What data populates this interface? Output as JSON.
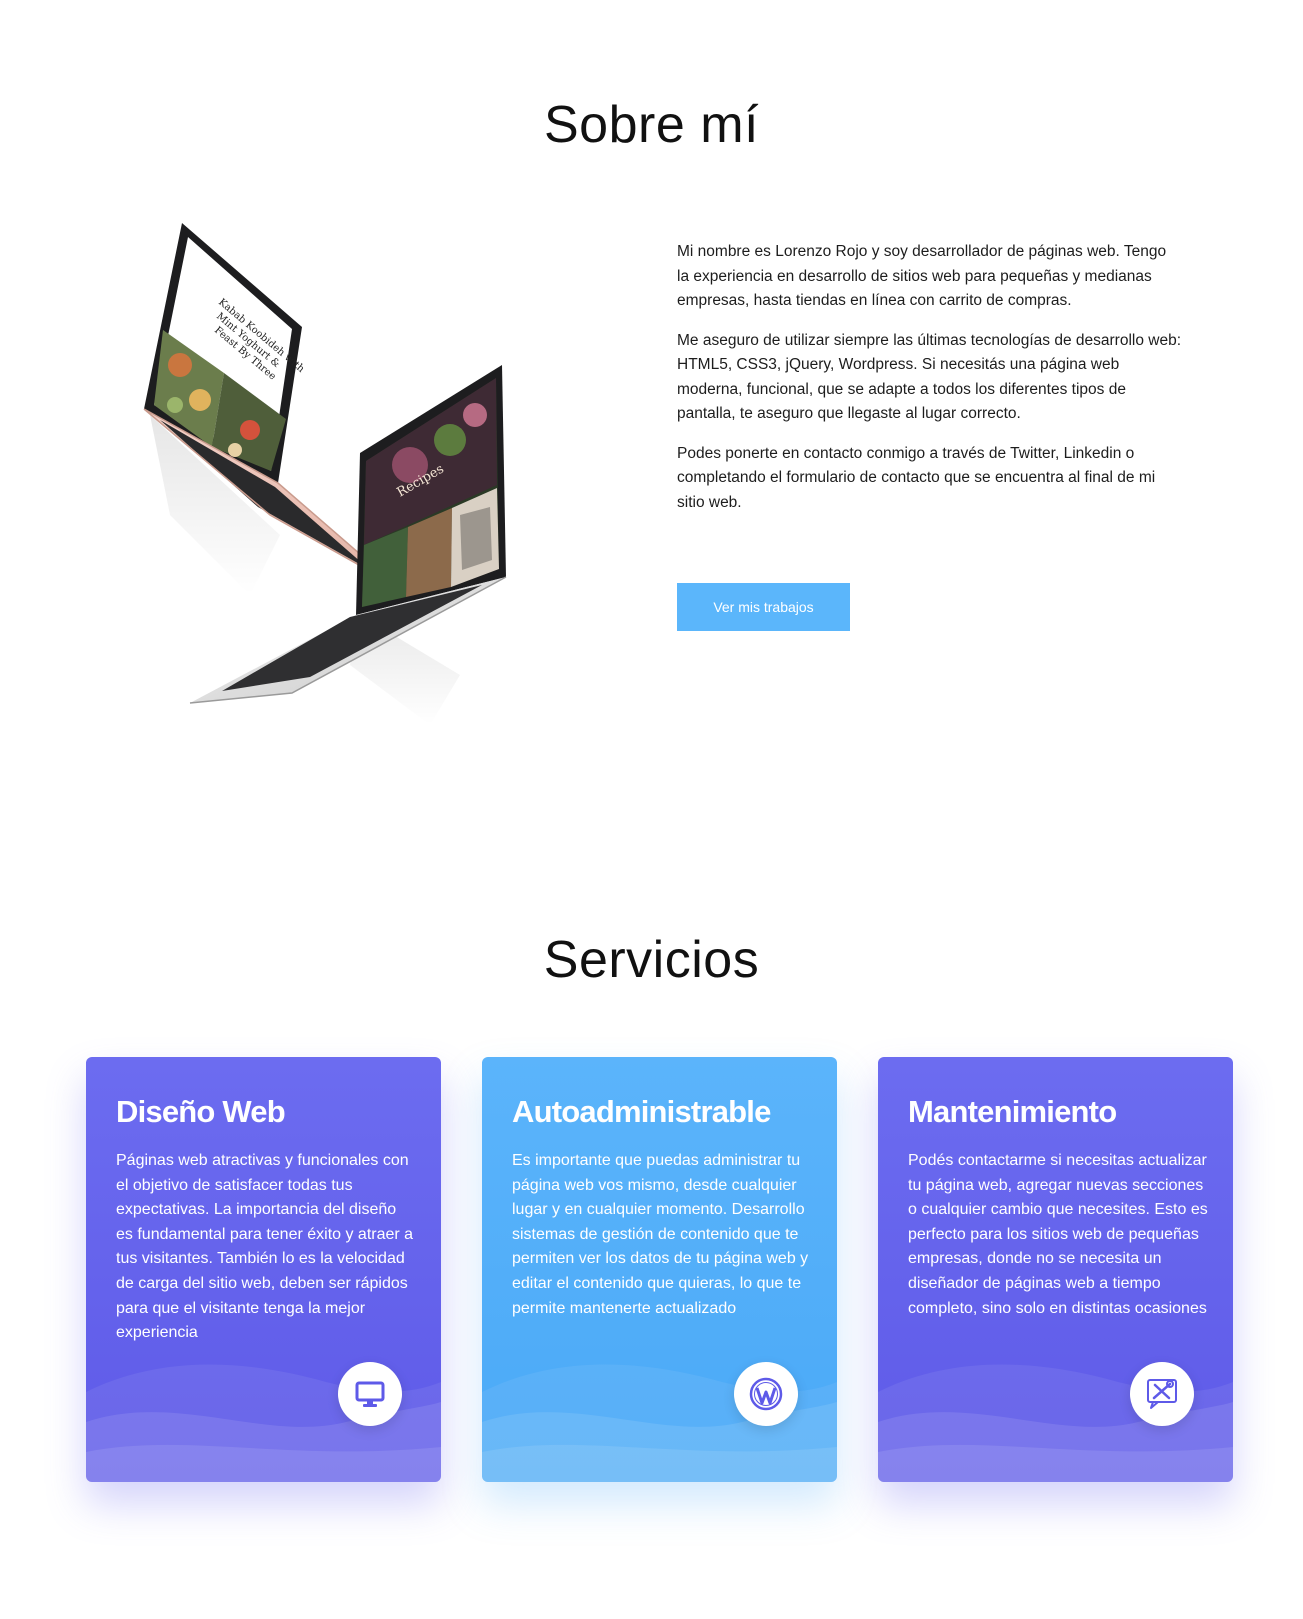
{
  "about": {
    "title": "Sobre mí",
    "paragraphs": [
      "Mi nombre es Lorenzo Rojo y soy desarrollador de páginas web. Tengo la experiencia en desarrollo de sitios web para pequeñas y medianas empresas, hasta tiendas en línea con carrito de compras.",
      "Me aseguro de utilizar siempre las últimas tecnologías de desarrollo web: HTML5, CSS3, jQuery, Wordpress. Si necesitás una página web moderna, funcional, que se adapte a todos los diferentes tipos de pantalla, te aseguro que llegaste al lugar correcto.",
      "Podes ponerte en contacto conmigo a través de Twitter, Linkedin o completando el formulario de contacto que se encuentra al final de mi sitio web."
    ],
    "button_label": "Ver mis trabajos",
    "image_screen_text": {
      "laptop_1": "Kabab Koobideh with Mint Yoghurt & Feast By Three",
      "laptop_2": "Recipes"
    }
  },
  "services": {
    "title": "Servicios",
    "cards": [
      {
        "title": "Diseño Web",
        "text": "Páginas web atractivas y funcionales con el objetivo de satisfacer todas tus expectativas. La importancia del diseño es fundamental para tener éxito y atraer a tus visitantes. También lo es la velocidad de carga del sitio web, deben ser rápidos para que el visitante tenga la mejor experiencia",
        "icon": "desktop-icon",
        "color": "#6666ee"
      },
      {
        "title": "Autoadministrable",
        "text": "Es importante que puedas administrar tu página web vos mismo, desde cualquier lugar y en cualquier momento. Desarrollo sistemas de gestión de contenido que te permiten ver los datos de tu página web y editar el contenido que quieras, lo que te permite mantenerte actualizado",
        "icon": "wordpress-icon",
        "color": "#56b2fb"
      },
      {
        "title": "Mantenimiento",
        "text": "Podés contactarme si necesitas actualizar tu página web, agregar nuevas secciones o cualquier cambio que necesites. Esto es perfecto para los sitios web de pequeñas empresas, donde no se necesita un diseñador de páginas web a tiempo completo, sino solo en distintas ocasiones",
        "icon": "tools-icon",
        "color": "#6666ee"
      }
    ]
  }
}
